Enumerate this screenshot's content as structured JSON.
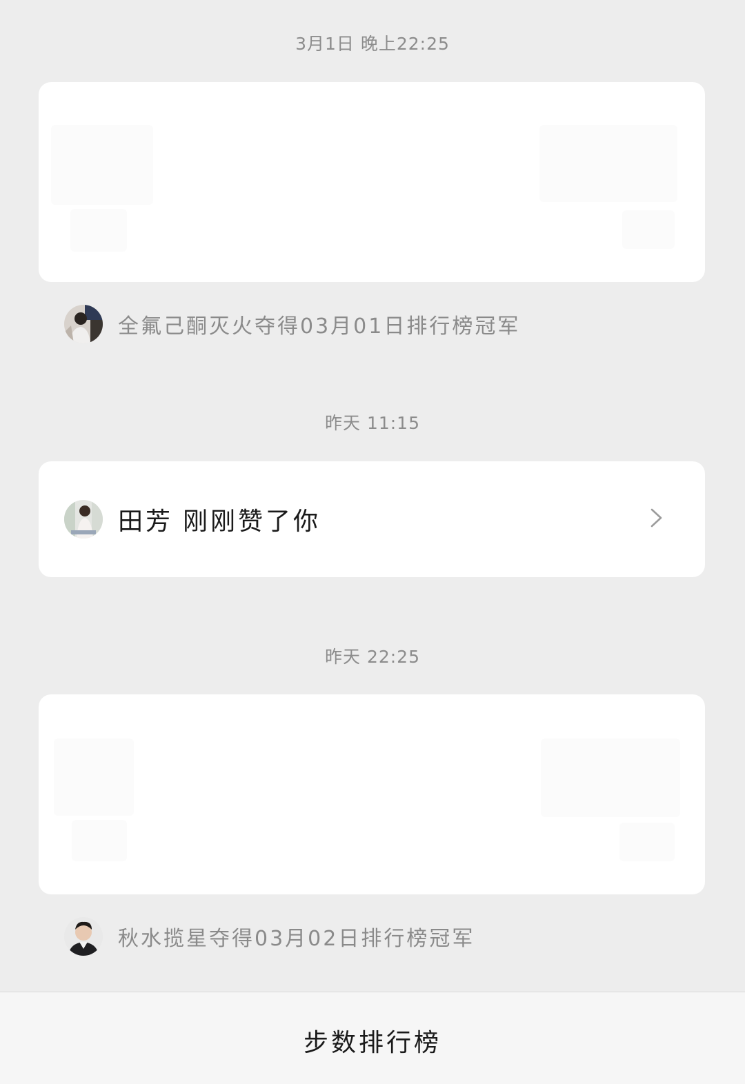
{
  "app": {
    "background": "#ededed"
  },
  "feed": [
    {
      "timestamp": "3月1日 晚上22:25",
      "card": "blank",
      "notice": {
        "text": "全氟己酮灭火夺得03月01日排行榜冠军",
        "avatar_icon": "user-avatar-icon"
      }
    },
    {
      "timestamp": "昨天 11:15",
      "card": "like",
      "like": {
        "name": "田芳",
        "action": "刚刚赞了你",
        "avatar_icon": "user-avatar-icon",
        "chevron_icon": "chevron-right-icon"
      }
    },
    {
      "timestamp": "昨天 22:25",
      "card": "blank",
      "notice": {
        "text": "秋水揽星夺得03月02日排行榜冠军",
        "avatar_icon": "user-avatar-icon"
      }
    }
  ],
  "bottom_bar": {
    "label": "步数排行榜"
  },
  "colors": {
    "card": "#ffffff",
    "muted_text": "#8a8a8a",
    "primary_text": "#1a1a1a"
  }
}
